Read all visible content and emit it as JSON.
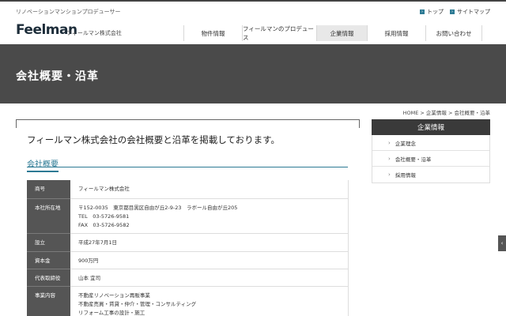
{
  "header": {
    "tagline": "リノベーションマンションプロデューサー",
    "toplinks": [
      {
        "label": "トップ"
      },
      {
        "label": "サイトマップ"
      }
    ],
    "logo": "Feelman",
    "logo_sub": "フィールマン株式会社"
  },
  "nav": {
    "items": [
      {
        "label": "物件情報",
        "active": false
      },
      {
        "label": "フィールマンのプロデュース",
        "active": false
      },
      {
        "label": "企業情報",
        "active": true
      },
      {
        "label": "採用情報",
        "active": false
      },
      {
        "label": "お問い合わせ",
        "active": false
      }
    ]
  },
  "hero": {
    "title": "会社概要・沿革"
  },
  "breadcrumb": "HOME > 企業情報 > 会社概要・沿革",
  "main": {
    "lead": "フィールマン株式会社の会社概要と沿革を掲載しております。",
    "section_title": "会社概要",
    "rows": [
      {
        "label": "商号",
        "lines": [
          "フィールマン株式会社"
        ]
      },
      {
        "label": "本社所在地",
        "lines": [
          "〒152-0035　東京都目黒区自由が丘2-9-23　ラボール自由が丘205",
          "TEL　03-5726-9581",
          "FAX　03-5726-9582"
        ]
      },
      {
        "label": "設立",
        "lines": [
          "平成27年7月1日"
        ]
      },
      {
        "label": "資本金",
        "lines": [
          "900万円"
        ]
      },
      {
        "label": "代表取締役",
        "lines": [
          "山本 宜司"
        ]
      },
      {
        "label": "事業内容",
        "lines": [
          "不動産リノベーション再販事業",
          "不動産売買・賃貸・仲介・管理・コンサルティング",
          "リフォーム工事の設計・施工"
        ]
      }
    ]
  },
  "sidebar": {
    "title": "企業情報",
    "items": [
      {
        "label": "企業理念"
      },
      {
        "label": "会社概要・沿革"
      },
      {
        "label": "採用情報"
      }
    ]
  },
  "colors": {
    "accent": "#2d7a94",
    "hero_bg": "#4a4a4a",
    "table_label_bg": "#555555"
  }
}
